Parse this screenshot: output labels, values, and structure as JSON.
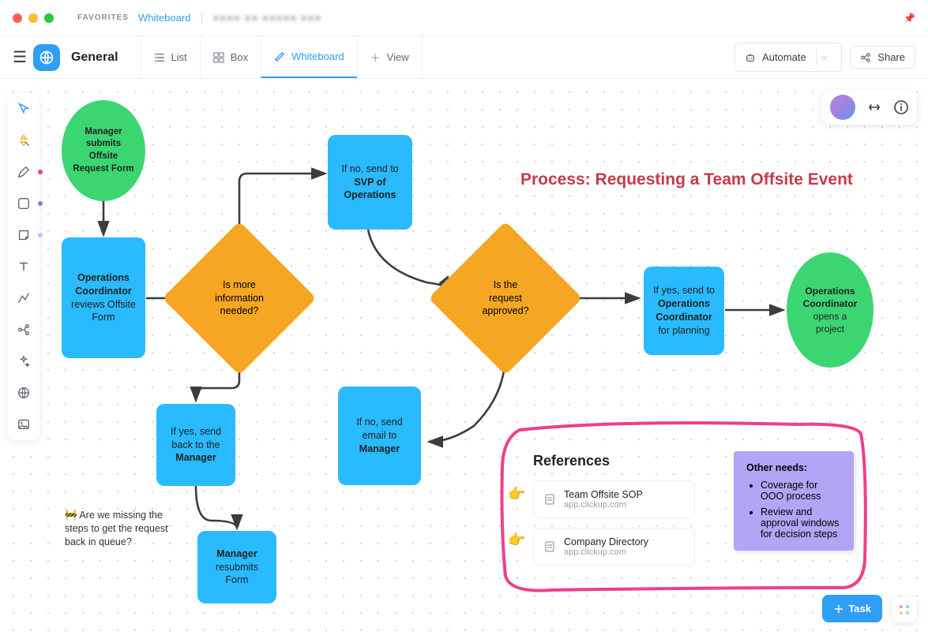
{
  "titlebar": {
    "favorites": "FAVORITES",
    "crumb_whiteboard": "Whiteboard",
    "crumb_blurred": "■■■■ ■■ ■■■■■ ■■■"
  },
  "toolbar": {
    "space_name": "General",
    "tabs": {
      "list": "List",
      "box": "Box",
      "whiteboard": "Whiteboard",
      "view": "View"
    },
    "automate": "Automate",
    "share": "Share"
  },
  "diagram": {
    "title": "Process: Requesting a Team Offsite Event",
    "start_circle_l1": "Manager",
    "start_circle_l2": "submits",
    "start_circle_l3": "Offsite",
    "start_circle_l4": "Request Form",
    "review_l1": "Operations",
    "review_l2": "Coordinator",
    "review_l3": "reviews Offsite",
    "review_l4": "Form",
    "d_moreinfo_l1": "Is more",
    "d_moreinfo_l2": "information",
    "d_moreinfo_l3": "needed?",
    "yes_back_l1": "If yes, send",
    "yes_back_l2": "back to the",
    "yes_back_l3": "Manager",
    "mgr_resub_l1": "Manager",
    "mgr_resub_l2": "resubmits",
    "mgr_resub_l3": "Form",
    "no_svp_l1": "If no, send to",
    "no_svp_l2": "SVP of",
    "no_svp_l3": "Operations",
    "d_approved_l1": "Is the",
    "d_approved_l2": "request",
    "d_approved_l3": "approved?",
    "no_email_l1": "If no, send",
    "no_email_l2": "email to",
    "no_email_l3": "Manager",
    "yes_plan_l1": "If yes, send to",
    "yes_plan_l2": "Operations",
    "yes_plan_l3": "Coordinator",
    "yes_plan_l4": "for planning",
    "end_circle_l1": "Operations",
    "end_circle_l2": "Coordinator",
    "end_circle_l3": "opens a",
    "end_circle_l4": "project",
    "comment": "🚧 Are we missing the steps to get the request back in queue?"
  },
  "refs": {
    "title": "References",
    "item1_title": "Team Offsite SOP",
    "item1_sub": "app.clickup.com",
    "item2_title": "Company Directory",
    "item2_sub": "app.clickup.com"
  },
  "sticky": {
    "title": "Other needs:",
    "li1": "Coverage for OOO process",
    "li2": "Review and approval windows for decision steps"
  },
  "taskbtn": "Task"
}
